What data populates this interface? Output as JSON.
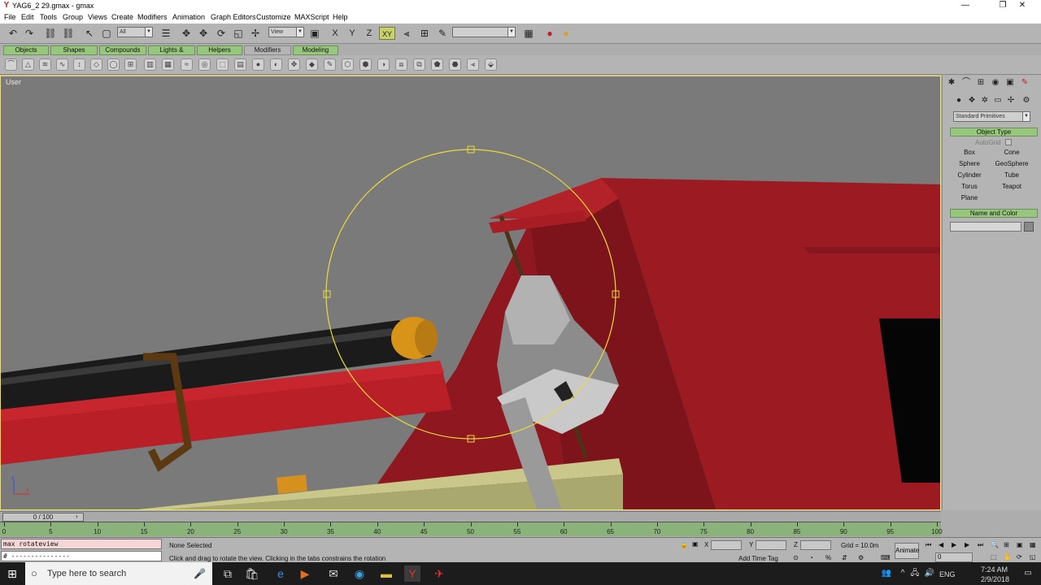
{
  "window": {
    "title": "YAG6_2 29.gmax - gmax",
    "app_icon": "gmax-icon",
    "minimize": "—",
    "maximize": "❐",
    "close": "✕"
  },
  "menu": [
    "File",
    "Edit",
    "Tools",
    "Group",
    "Views",
    "Create",
    "Modifiers",
    "Animation",
    "Graph Editors",
    "Customize",
    "MAXScript",
    "Help"
  ],
  "toolbar": {
    "selection_filter": "All",
    "reference_coord": "View",
    "axis_x": "X",
    "axis_y": "Y",
    "axis_z": "Z",
    "axis_xy": "XY",
    "named_selection": ""
  },
  "tabs": [
    {
      "label": "Objects",
      "active": false
    },
    {
      "label": "Shapes",
      "active": false
    },
    {
      "label": "Compounds",
      "active": false
    },
    {
      "label": "Lights & Cameras",
      "active": false
    },
    {
      "label": "Helpers",
      "active": false
    },
    {
      "label": "Modifiers",
      "active": true
    },
    {
      "label": "Modeling",
      "active": false
    }
  ],
  "viewport": {
    "label": "User",
    "axis_x": "x",
    "axis_z": "z"
  },
  "command_panel": {
    "category": "Standard Primitives",
    "object_type_header": "Object Type",
    "autogrid": "AutoGrid",
    "primitives": [
      "Box",
      "Cone",
      "Sphere",
      "GeoSphere",
      "Cylinder",
      "Tube",
      "Torus",
      "Teapot",
      "Plane"
    ],
    "name_color_header": "Name and Color",
    "name_value": ""
  },
  "time_slider": {
    "label": "0 / 100",
    "frames": [
      "0",
      "5",
      "10",
      "15",
      "20",
      "25",
      "30",
      "35",
      "40",
      "45",
      "50",
      "55",
      "60",
      "65",
      "70",
      "75",
      "80",
      "85",
      "90",
      "95",
      "100"
    ]
  },
  "status": {
    "listener_line1": "max rotateview",
    "listener_line2": "# ---------------",
    "selection": "None Selected",
    "prompt": "Click and drag to rotate the view.  Clicking in the tabs constrains the rotation",
    "x_label": "X",
    "y_label": "Y",
    "z_label": "Z",
    "grid": "Grid = 10.0m",
    "add_time_tag": "Add Time Tag",
    "animate": "Animate",
    "frame": "0"
  },
  "taskbar": {
    "search_placeholder": "Type here to search",
    "language": "ENG",
    "time": "7:24 AM",
    "date": "2/9/2018"
  }
}
